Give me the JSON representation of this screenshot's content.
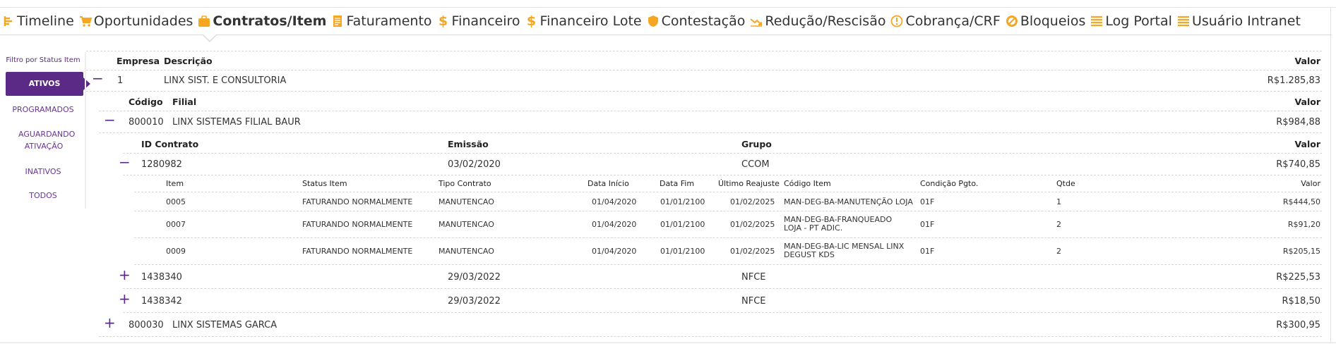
{
  "tabs": [
    {
      "label": "Timeline",
      "icon": "timeline-icon",
      "color": "#f5a623"
    },
    {
      "label": "Oportunidades",
      "icon": "cart-icon",
      "color": "#f5a623"
    },
    {
      "label": "Contratos/Item",
      "icon": "briefcase-icon",
      "color": "#f5a623",
      "active": true
    },
    {
      "label": "Faturamento",
      "icon": "document-icon",
      "color": "#f5a623"
    },
    {
      "label": "Financeiro",
      "icon": "dollar-icon",
      "color": "#f5a623"
    },
    {
      "label": "Financeiro Lote",
      "icon": "dollar-icon",
      "color": "#f5a623"
    },
    {
      "label": "Contestação",
      "icon": "shield-icon",
      "color": "#f5a623"
    },
    {
      "label": "Redução/Rescisão",
      "icon": "trend-down-icon",
      "color": "#f5a623"
    },
    {
      "label": "Cobrança/CRF",
      "icon": "alert-circle-icon",
      "color": "#f5a623"
    },
    {
      "label": "Bloqueios",
      "icon": "block-icon",
      "color": "#f5a623"
    },
    {
      "label": "Log Portal",
      "icon": "list-icon",
      "color": "#f5a623"
    },
    {
      "label": "Usuário Intranet",
      "icon": "list-icon",
      "color": "#f5a623"
    }
  ],
  "sidebar": {
    "title": "Filtro por Status Item",
    "filters": [
      "ATIVOS",
      "PROGRAMADOS",
      "AGUARDANDO ATIVAÇÃO",
      "INATIVOS",
      "TODOS"
    ],
    "active": "ATIVOS"
  },
  "empresa": {
    "headers": {
      "empresa": "Empresa",
      "descricao": "Descrição",
      "valor": "Valor"
    },
    "row": {
      "toggle": "−",
      "empresa": "1",
      "descricao": "LINX SIST. E CONSULTORIA",
      "valor": "R$1.285,83"
    }
  },
  "filial": {
    "headers": {
      "codigo": "Código",
      "filial": "Filial",
      "valor": "Valor"
    },
    "rows": [
      {
        "toggle": "−",
        "codigo": "800010",
        "filial": "LINX SISTEMAS FILIAL BAUR",
        "valor": "R$984,88"
      },
      {
        "toggle": "+",
        "codigo": "800030",
        "filial": "LINX SISTEMAS GARCA",
        "valor": "R$300,95"
      }
    ]
  },
  "contrato": {
    "headers": {
      "id": "ID Contrato",
      "emissao": "Emissão",
      "grupo": "Grupo",
      "valor": "Valor"
    },
    "rows": [
      {
        "toggle": "−",
        "id": "1280982",
        "emissao": "03/02/2020",
        "grupo": "CCOM",
        "valor": "R$740,85"
      },
      {
        "toggle": "+",
        "id": "1438340",
        "emissao": "29/03/2022",
        "grupo": "NFCE",
        "valor": "R$225,53"
      },
      {
        "toggle": "+",
        "id": "1438342",
        "emissao": "29/03/2022",
        "grupo": "NFCE",
        "valor": "R$18,50"
      }
    ]
  },
  "itens": {
    "headers": {
      "item": "Item",
      "status": "Status Item",
      "tipo": "Tipo Contrato",
      "inicio": "Data Início",
      "fim": "Data Fim",
      "reajuste": "Último Reajuste",
      "codigo": "Código Item",
      "condicao": "Condição Pgto.",
      "qtde": "Qtde",
      "valor": "Valor"
    },
    "rows": [
      {
        "item": "0005",
        "status": "FATURANDO NORMALMENTE",
        "tipo": "MANUTENCAO",
        "inicio": "01/04/2020",
        "fim": "01/01/2100",
        "reajuste": "01/02/2025",
        "codigo": "MAN-DEG-BA-MANUTENÇÃO LOJA",
        "condicao": "01F",
        "qtde": "1",
        "valor": "R$444,50"
      },
      {
        "item": "0007",
        "status": "FATURANDO NORMALMENTE",
        "tipo": "MANUTENCAO",
        "inicio": "01/04/2020",
        "fim": "01/01/2100",
        "reajuste": "01/02/2025",
        "codigo": "MAN-DEG-BA-FRANQUEADO LOJA - PT ADIC.",
        "condicao": "01F",
        "qtde": "2",
        "valor": "R$91,20"
      },
      {
        "item": "0009",
        "status": "FATURANDO NORMALMENTE",
        "tipo": "MANUTENCAO",
        "inicio": "01/04/2020",
        "fim": "01/01/2100",
        "reajuste": "01/02/2025",
        "codigo": "MAN-DEG-BA-LIC MENSAL LINX DEGUST KDS",
        "condicao": "01F",
        "qtde": "2",
        "valor": "R$205,15"
      }
    ]
  }
}
